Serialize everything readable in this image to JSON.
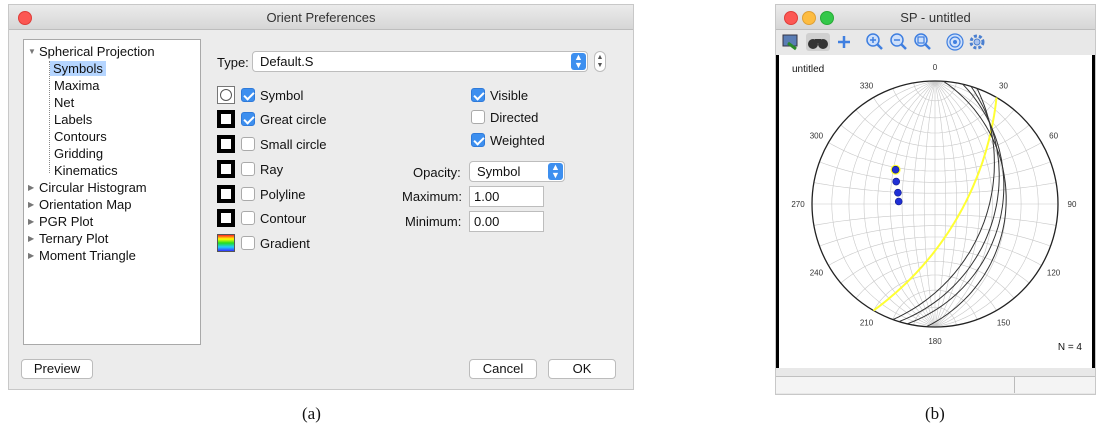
{
  "left_window": {
    "title": "Orient Preferences",
    "tree": [
      {
        "label": "Spherical Projection",
        "expanded": true
      },
      {
        "label": "Symbols",
        "selected": true
      },
      {
        "label": "Maxima"
      },
      {
        "label": "Net"
      },
      {
        "label": "Labels"
      },
      {
        "label": "Contours"
      },
      {
        "label": "Gridding"
      },
      {
        "label": "Kinematics"
      },
      {
        "label": "Circular Histogram",
        "expanded": false
      },
      {
        "label": "Orientation Map",
        "expanded": false
      },
      {
        "label": "PGR Plot",
        "expanded": false
      },
      {
        "label": "Ternary Plot",
        "expanded": false
      },
      {
        "label": "Moment Triangle",
        "expanded": false
      }
    ],
    "type_label": "Type:",
    "type_value": "Default.S",
    "elements": [
      {
        "label": "Symbol",
        "checked": true,
        "swatch": "circle"
      },
      {
        "label": "Great circle",
        "checked": true,
        "swatch": "square"
      },
      {
        "label": "Small circle",
        "checked": false,
        "swatch": "square"
      },
      {
        "label": "Ray",
        "checked": false,
        "swatch": "square"
      },
      {
        "label": "Polyline",
        "checked": false,
        "swatch": "square"
      },
      {
        "label": "Contour",
        "checked": false,
        "swatch": "square"
      },
      {
        "label": "Gradient",
        "checked": false,
        "swatch": "gradient"
      }
    ],
    "options": [
      {
        "label": "Visible",
        "checked": true
      },
      {
        "label": "Directed",
        "checked": false
      },
      {
        "label": "Weighted",
        "checked": true
      }
    ],
    "opacity_label": "Opacity:",
    "opacity_value": "Symbol",
    "maximum_label": "Maximum:",
    "maximum_value": "1.00",
    "minimum_label": "Minimum:",
    "minimum_value": "0.00",
    "preview_label": "Preview",
    "cancel_label": "Cancel",
    "ok_label": "OK",
    "accent_color": "#3d8fef",
    "selection_color": "#b5d5ff"
  },
  "right_window": {
    "title": "SP - untitled",
    "toolbar_icons": [
      "export-icon",
      "binoculars-icon",
      "plus-icon",
      "zoom-in-icon",
      "zoom-out-icon",
      "zoom-fit-icon",
      "target-icon",
      "gear-icon"
    ],
    "plot": {
      "name": "untitled",
      "count_label": "N = 4",
      "azimuth_labels": [
        {
          "az": 0,
          "text": "0"
        },
        {
          "az": 30,
          "text": "30"
        },
        {
          "az": 60,
          "text": "60"
        },
        {
          "az": 90,
          "text": "90"
        },
        {
          "az": 120,
          "text": "120"
        },
        {
          "az": 150,
          "text": "150"
        },
        {
          "az": 180,
          "text": "180"
        },
        {
          "az": 210,
          "text": "210"
        },
        {
          "az": 240,
          "text": "240"
        },
        {
          "az": 270,
          "text": "270"
        },
        {
          "az": 300,
          "text": "300"
        },
        {
          "az": 330,
          "text": "330"
        }
      ],
      "poles": [
        {
          "trend": 311,
          "plunge": 44,
          "highlight": true
        },
        {
          "trend": 300,
          "plunge": 50,
          "highlight": false
        },
        {
          "trend": 287,
          "plunge": 55,
          "highlight": false
        },
        {
          "trend": 274,
          "plunge": 57,
          "highlight": false
        }
      ],
      "great_circles": [
        {
          "strike": 30,
          "dip": 66,
          "color": "#ffff33"
        },
        {
          "strike": 20,
          "dip": 44,
          "color": "#333333"
        },
        {
          "strike": 17,
          "dip": 38,
          "color": "#333333"
        },
        {
          "strike": 13,
          "dip": 33,
          "color": "#333333"
        },
        {
          "strike": 4,
          "dip": 30,
          "color": "#333333"
        }
      ],
      "pole_color": "#1f2fd6",
      "pole_highlight_color": "#ffff33"
    }
  },
  "captions": {
    "left": "(a)",
    "right": "(b)"
  }
}
